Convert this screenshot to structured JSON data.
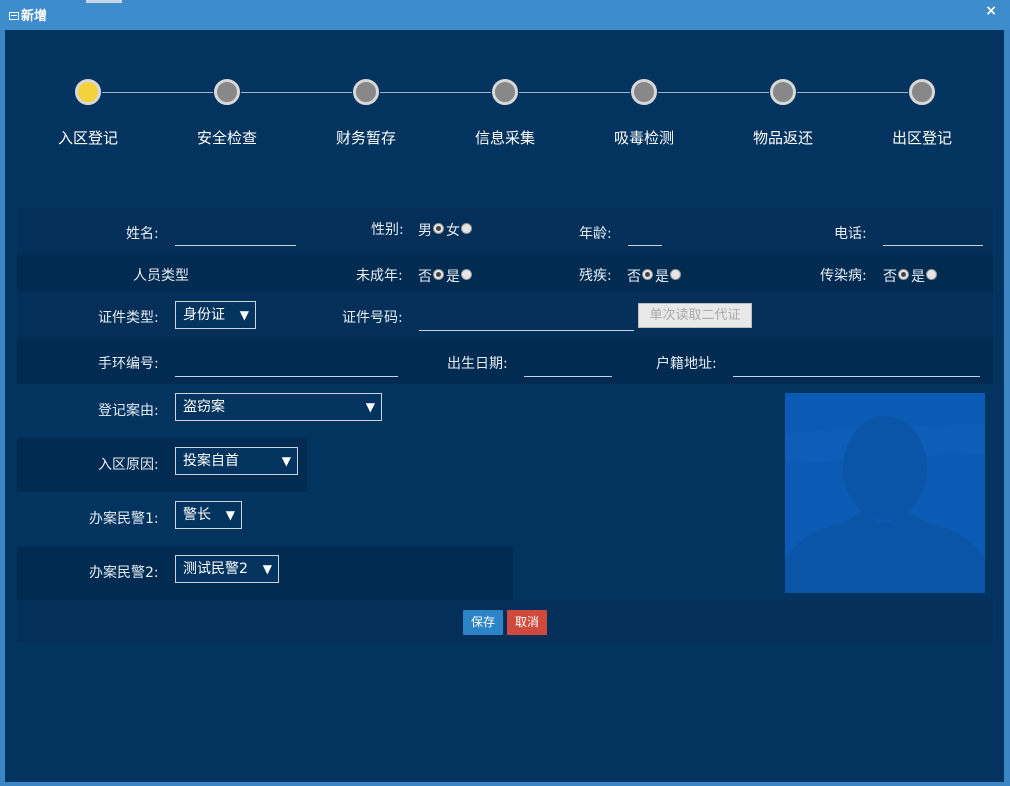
{
  "window": {
    "title": "新增",
    "close_label": "×"
  },
  "steps": [
    "入区登记",
    "安全检查",
    "财务暂存",
    "信息采集",
    "吸毒检测",
    "物品返还",
    "出区登记"
  ],
  "active_step": 0,
  "form": {
    "name_label": "姓名:",
    "gender_label": "性别:",
    "gender_options": [
      "男",
      "女"
    ],
    "age_label": "年龄:",
    "phone_label": "电话:",
    "person_type_label": "人员类型",
    "minor_label": "未成年:",
    "disabled_label": "残疾:",
    "infectious_label": "传染病:",
    "no_label": "否",
    "yes_label": "是",
    "id_type_label": "证件类型:",
    "id_type_value": "身份证",
    "id_number_label": "证件号码:",
    "read_id_button": "单次读取二代证",
    "bracelet_label": "手环编号:",
    "birth_label": "出生日期:",
    "address_label": "户籍地址:",
    "case_label": "登记案由:",
    "case_value": "盗窃案",
    "reason_label": "入区原因:",
    "reason_value": "投案自首",
    "officer1_label": "办案民警1:",
    "officer1_value": "警长",
    "officer2_label": "办案民警2:",
    "officer2_value": "测试民警2",
    "save_button": "保存",
    "cancel_button": "取消"
  },
  "colors": {
    "accent": "#2c84c6",
    "danger": "#cf4a3c",
    "active_step": "#f3d23c",
    "background": "#03335f"
  }
}
